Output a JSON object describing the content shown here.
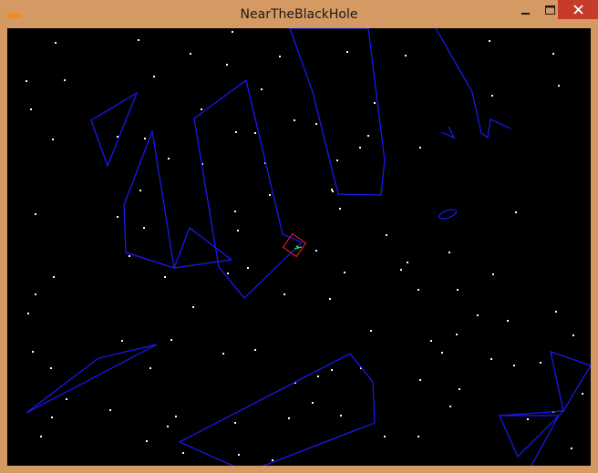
{
  "window": {
    "title": "NearTheBlackHole",
    "frame_color": "#d59a63",
    "close_color": "#c73b2b"
  },
  "titlebar": {
    "app_icon": "app-icon",
    "minimize_icon": "minimize-icon",
    "maximize_icon": "maximize-icon",
    "close_icon": "close-icon"
  },
  "game": {
    "background": "#000000",
    "asteroid_color": "#1a1aff",
    "star_color": "#ffffff",
    "ship_box_color": "#ff2020",
    "ship_color": "#20e060"
  }
}
